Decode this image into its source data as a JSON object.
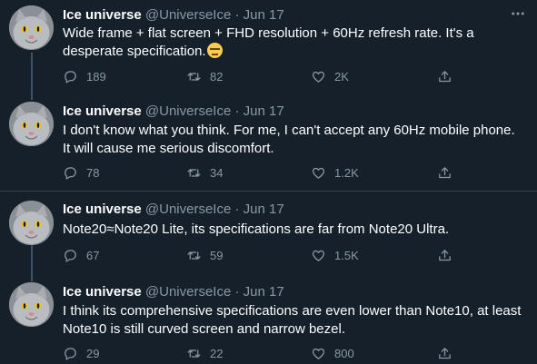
{
  "tweets": [
    {
      "name": "Ice universe",
      "handle": "@UniverseIce",
      "dot": "·",
      "date": "Jun 17",
      "text": "Wide frame + flat screen + FHD resolution + 60Hz refresh rate. It's a desperate specification.",
      "emoji": "expressionless-face-emoji",
      "replies": "189",
      "retweets": "82",
      "likes": "2K"
    },
    {
      "name": "Ice universe",
      "handle": "@UniverseIce",
      "dot": "·",
      "date": "Jun 17",
      "text": "I don't know what you think. For me, I can't accept any 60Hz mobile phone. It will cause me serious discomfort.",
      "replies": "78",
      "retweets": "34",
      "likes": "1.2K"
    },
    {
      "name": "Ice universe",
      "handle": "@UniverseIce",
      "dot": "·",
      "date": "Jun 17",
      "text": "Note20≈Note20 Lite, its specifications are far from Note20 Ultra.",
      "replies": "67",
      "retweets": "59",
      "likes": "1.5K"
    },
    {
      "name": "Ice universe",
      "handle": "@UniverseIce",
      "dot": "·",
      "date": "Jun 17",
      "text": "I think its comprehensive specifications are even lower than Note10, at least Note10 is still curved screen and narrow bezel.",
      "replies": "29",
      "retweets": "22",
      "likes": "800"
    }
  ],
  "icons": {
    "reply": "reply-icon",
    "retweet": "retweet-icon",
    "like": "heart-icon",
    "share": "share-icon",
    "more": "more-icon"
  },
  "colors": {
    "background": "#15202b",
    "secondary_text": "#8899a6",
    "separator": "#38444d"
  }
}
